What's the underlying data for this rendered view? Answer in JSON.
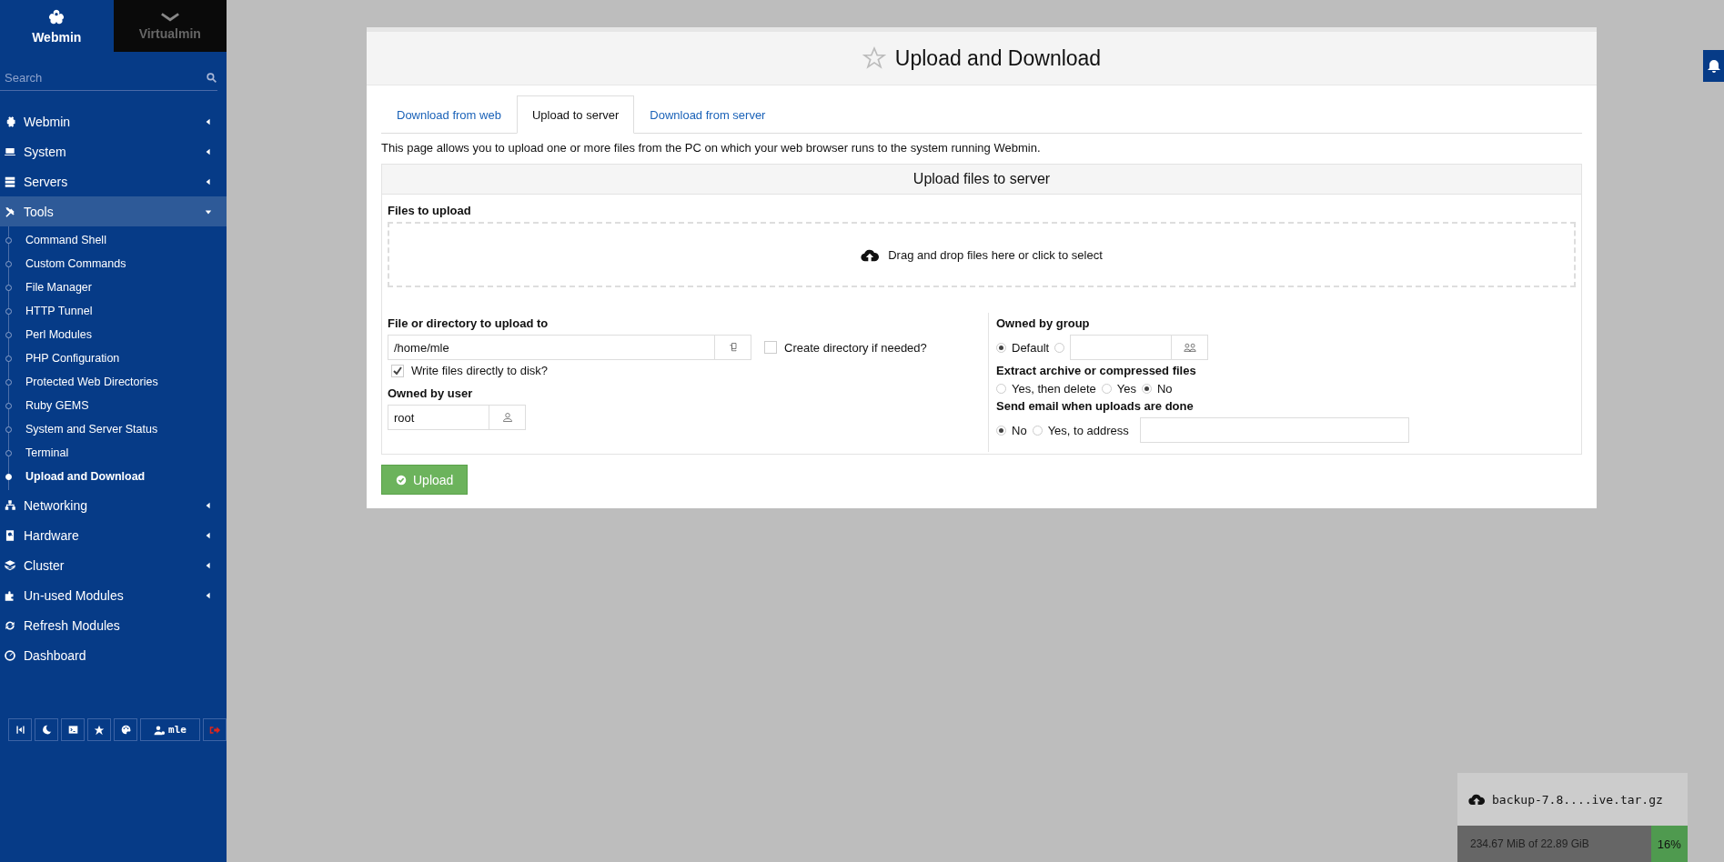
{
  "sidebar": {
    "switcher": [
      {
        "label": "Webmin",
        "selected": true
      },
      {
        "label": "Virtualmin",
        "selected": false
      }
    ],
    "search": {
      "placeholder": "Search"
    },
    "items": [
      {
        "label": "Webmin",
        "kind": "category",
        "expanded": false
      },
      {
        "label": "System",
        "kind": "category",
        "expanded": false
      },
      {
        "label": "Servers",
        "kind": "category",
        "expanded": false
      },
      {
        "label": "Tools",
        "kind": "category",
        "expanded": true,
        "children": [
          {
            "label": "Command Shell",
            "selected": false
          },
          {
            "label": "Custom Commands",
            "selected": false
          },
          {
            "label": "File Manager",
            "selected": false
          },
          {
            "label": "HTTP Tunnel",
            "selected": false
          },
          {
            "label": "Perl Modules",
            "selected": false
          },
          {
            "label": "PHP Configuration",
            "selected": false
          },
          {
            "label": "Protected Web Directories",
            "selected": false
          },
          {
            "label": "Ruby GEMS",
            "selected": false
          },
          {
            "label": "System and Server Status",
            "selected": false
          },
          {
            "label": "Terminal",
            "selected": false
          },
          {
            "label": "Upload and Download",
            "selected": true
          }
        ]
      },
      {
        "label": "Networking",
        "kind": "category",
        "expanded": false
      },
      {
        "label": "Hardware",
        "kind": "category",
        "expanded": false
      },
      {
        "label": "Cluster",
        "kind": "category",
        "expanded": false
      },
      {
        "label": "Un-used Modules",
        "kind": "category",
        "expanded": false
      },
      {
        "label": "Refresh Modules",
        "kind": "link"
      },
      {
        "label": "Dashboard",
        "kind": "link"
      }
    ],
    "toolbar": {
      "user": "mle"
    }
  },
  "page": {
    "title": "Upload and Download",
    "tabs": [
      {
        "label": "Download from web",
        "selected": false
      },
      {
        "label": "Upload to server",
        "selected": true
      },
      {
        "label": "Download from server",
        "selected": false
      }
    ],
    "description": "This page allows you to upload one or more files from the PC on which your web browser runs to the system running Webmin.",
    "form": {
      "title": "Upload files to server",
      "files_label": "Files to upload",
      "dropzone": "Drag and drop files here or click to select",
      "target_label": "File or directory to upload to",
      "target_value": "/home/mle",
      "create_dir": {
        "label": "Create directory if needed?",
        "checked": false
      },
      "write_direct": {
        "label": "Write files directly to disk?",
        "checked": true
      },
      "user_label": "Owned by user",
      "user_value": "root",
      "group_label": "Owned by group",
      "group_options": [
        {
          "label": "Default",
          "selected": true
        },
        {
          "selected": false
        }
      ],
      "extract_label": "Extract archive or compressed files",
      "extract_options": [
        {
          "label": "Yes, then delete",
          "selected": false
        },
        {
          "label": "Yes",
          "selected": false
        },
        {
          "label": "No",
          "selected": true
        }
      ],
      "email_label": "Send email when uploads are done",
      "email_options": [
        {
          "label": "No",
          "selected": true
        },
        {
          "label": "Yes, to address",
          "selected": false
        }
      ]
    },
    "submit": "Upload"
  },
  "upload_progress": {
    "filename": "backup-7.8....ive.tar.gz",
    "size": "234.67 MiB of 22.89 GiB",
    "percent": "16%",
    "level": 0.16
  }
}
